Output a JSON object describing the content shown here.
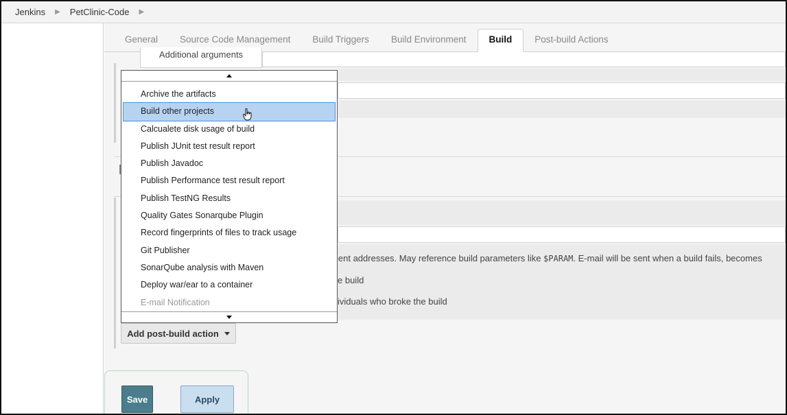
{
  "breadcrumb": {
    "items": [
      "Jenkins",
      "PetClinic-Code"
    ]
  },
  "tabs": [
    {
      "label": "General",
      "active": false
    },
    {
      "label": "Source Code Management",
      "active": false
    },
    {
      "label": "Build Triggers",
      "active": false
    },
    {
      "label": "Build Environment",
      "active": false
    },
    {
      "label": "Build",
      "active": true
    },
    {
      "label": "Post-build Actions",
      "active": false
    }
  ],
  "section": {
    "additional_args_label": "Additional arguments"
  },
  "email": {
    "help_text_prefix": "ient addresses. May reference build parameters like ",
    "help_text_param": "$PARAM",
    "help_text_suffix": ". E-mail will be sent when a build fails, becomes",
    "option1_tail": "e build",
    "option2_tail": "ividuals who broke the build"
  },
  "dropdown": {
    "items": [
      {
        "label": "Archive the artifacts",
        "state": "normal"
      },
      {
        "label": "Build other projects",
        "state": "selected"
      },
      {
        "label": "Calcualete disk usage of build",
        "state": "normal"
      },
      {
        "label": "Publish JUnit test result report",
        "state": "normal"
      },
      {
        "label": "Publish Javadoc",
        "state": "normal"
      },
      {
        "label": "Publish Performance test result report",
        "state": "normal"
      },
      {
        "label": "Publish TestNG Results",
        "state": "normal"
      },
      {
        "label": "Quality Gates Sonarqube Plugin",
        "state": "normal"
      },
      {
        "label": "Record fingerprints of files to track usage",
        "state": "normal"
      },
      {
        "label": "Git Publisher",
        "state": "normal"
      },
      {
        "label": "SonarQube analysis with Maven",
        "state": "normal"
      },
      {
        "label": "Deploy war/ear to a container",
        "state": "normal"
      },
      {
        "label": "E-mail Notification",
        "state": "disabled"
      }
    ]
  },
  "buttons": {
    "add_post_build": "Add post-build action",
    "save": "Save",
    "apply": "Apply"
  },
  "colors": {
    "selected_bg": "#b7d3f2",
    "save_bg": "#4b7d8c",
    "apply_bg": "#c9dff0"
  }
}
